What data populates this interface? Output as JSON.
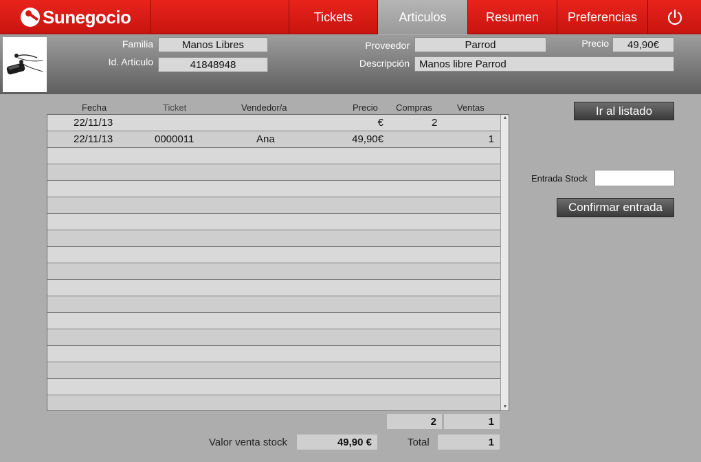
{
  "brand": {
    "name": "Sunegocio"
  },
  "nav": {
    "tabs": [
      {
        "label": "Tickets"
      },
      {
        "label": "Articulos"
      },
      {
        "label": "Resumen"
      },
      {
        "label": "Preferencias"
      }
    ],
    "active_tab": "Articulos",
    "power_icon": "power-icon"
  },
  "article": {
    "familia_label": "Familia",
    "familia_value": "Manos Libres",
    "id_label": "Id. Articulo",
    "id_value": "41848948",
    "proveedor_label": "Proveedor",
    "proveedor_value": "Parrod",
    "descripcion_label": "Descripción",
    "descripcion_value": "Manos libre Parrod",
    "precio_label": "Precio",
    "precio_value": "49,90€",
    "image_icon": "headset-product-image"
  },
  "table": {
    "columns": [
      "Fecha",
      "Ticket",
      "Vendedor/a",
      "Precio",
      "Compras",
      "Ventas"
    ],
    "rows": [
      {
        "fecha": "22/11/13",
        "ticket": "",
        "vendedor": "",
        "precio": "€",
        "compras": "2",
        "ventas": ""
      },
      {
        "fecha": "22/11/13",
        "ticket": "0000011",
        "vendedor": "Ana",
        "precio": "49,90€",
        "compras": "",
        "ventas": "1"
      }
    ]
  },
  "actions": {
    "ir_listado": "Ir al listado",
    "entrada_stock_label": "Entrada Stock",
    "confirmar": "Confirmar entrada"
  },
  "totals": {
    "compras_total": "2",
    "ventas_total": "1",
    "valor_label": "Valor venta stock",
    "valor_value": "49,90 €",
    "total_label": "Total",
    "total_value": "1"
  },
  "colors": {
    "brand_red": "#d4180f",
    "panel_gray": "#adadad"
  }
}
